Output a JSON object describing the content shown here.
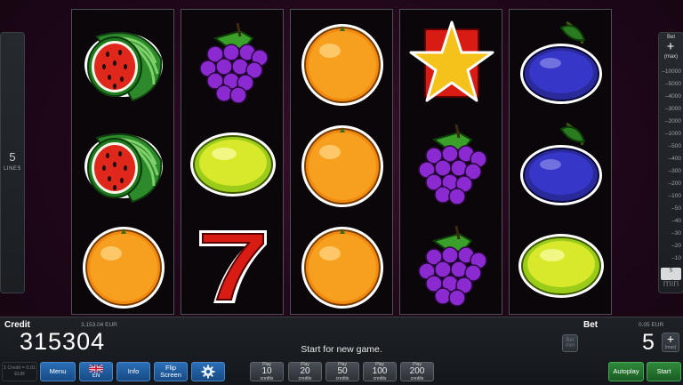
{
  "lines": {
    "count": "5",
    "label": "LINES"
  },
  "bet_panel": {
    "title": "Bet",
    "plus": "+",
    "max_label": "(max)",
    "levels": [
      "10000",
      "5000",
      "4000",
      "3000",
      "2000",
      "1000",
      "500",
      "400",
      "300",
      "200",
      "100",
      "50",
      "40",
      "30",
      "20",
      "10",
      "5"
    ],
    "selected": "5",
    "bet_label": "Bet",
    "min_label": "min"
  },
  "reels": [
    [
      "watermelon",
      "watermelon",
      "orange"
    ],
    [
      "grapes",
      "lemon",
      "seven"
    ],
    [
      "orange",
      "orange",
      "orange"
    ],
    [
      "star",
      "grapes",
      "grapes"
    ],
    [
      "plum",
      "plum",
      "lemon"
    ]
  ],
  "credit": {
    "label": "Credit",
    "eur": "3,153.04 EUR",
    "value": "315304"
  },
  "status": "Start for new game.",
  "bet": {
    "label": "Bet",
    "eur": "0.05 EUR",
    "value": "5",
    "min": "Bet min",
    "max": "(max)"
  },
  "rate": "1 Credit = 0.01 EUR",
  "buttons": {
    "menu": "Menu",
    "lang": "EN",
    "info": "Info",
    "flip_line1": "Flip",
    "flip_line2": "Screen",
    "play": [
      {
        "top": "Play",
        "value": "10",
        "unit": "credits"
      },
      {
        "top": "Play",
        "value": "20",
        "unit": "credits"
      },
      {
        "top": "Play",
        "value": "50",
        "unit": "credits"
      },
      {
        "top": "Play",
        "value": "100",
        "unit": "credits"
      },
      {
        "top": "Play",
        "value": "200",
        "unit": "credits"
      }
    ],
    "autoplay": "Autoplay",
    "start": "Start"
  },
  "colors": {
    "accent_blue": "#1f5fa6",
    "start_green": "#2f8a3a",
    "bg": "#22081a"
  }
}
